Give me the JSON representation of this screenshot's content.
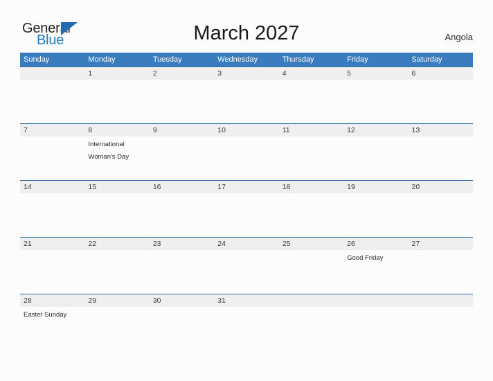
{
  "brand": {
    "name_part1": "General",
    "name_part2": "Blue",
    "accent_color": "#1f7bc1"
  },
  "header": {
    "title": "March 2027",
    "country": "Angola"
  },
  "calendar": {
    "header_bg": "#3a7cbe",
    "band_bg": "#efefef",
    "weekdays": [
      "Sunday",
      "Monday",
      "Tuesday",
      "Wednesday",
      "Thursday",
      "Friday",
      "Saturday"
    ],
    "weeks": [
      [
        {
          "day": "",
          "event": ""
        },
        {
          "day": "1",
          "event": ""
        },
        {
          "day": "2",
          "event": ""
        },
        {
          "day": "3",
          "event": ""
        },
        {
          "day": "4",
          "event": ""
        },
        {
          "day": "5",
          "event": ""
        },
        {
          "day": "6",
          "event": ""
        }
      ],
      [
        {
          "day": "7",
          "event": ""
        },
        {
          "day": "8",
          "event": "International\nWoman's Day"
        },
        {
          "day": "9",
          "event": ""
        },
        {
          "day": "10",
          "event": ""
        },
        {
          "day": "11",
          "event": ""
        },
        {
          "day": "12",
          "event": ""
        },
        {
          "day": "13",
          "event": ""
        }
      ],
      [
        {
          "day": "14",
          "event": ""
        },
        {
          "day": "15",
          "event": ""
        },
        {
          "day": "16",
          "event": ""
        },
        {
          "day": "17",
          "event": ""
        },
        {
          "day": "18",
          "event": ""
        },
        {
          "day": "19",
          "event": ""
        },
        {
          "day": "20",
          "event": ""
        }
      ],
      [
        {
          "day": "21",
          "event": ""
        },
        {
          "day": "22",
          "event": ""
        },
        {
          "day": "23",
          "event": ""
        },
        {
          "day": "24",
          "event": ""
        },
        {
          "day": "25",
          "event": ""
        },
        {
          "day": "26",
          "event": "Good Friday"
        },
        {
          "day": "27",
          "event": ""
        }
      ],
      [
        {
          "day": "28",
          "event": "Easter Sunday"
        },
        {
          "day": "29",
          "event": ""
        },
        {
          "day": "30",
          "event": ""
        },
        {
          "day": "31",
          "event": ""
        },
        {
          "day": "",
          "event": ""
        },
        {
          "day": "",
          "event": ""
        },
        {
          "day": "",
          "event": ""
        }
      ]
    ]
  }
}
